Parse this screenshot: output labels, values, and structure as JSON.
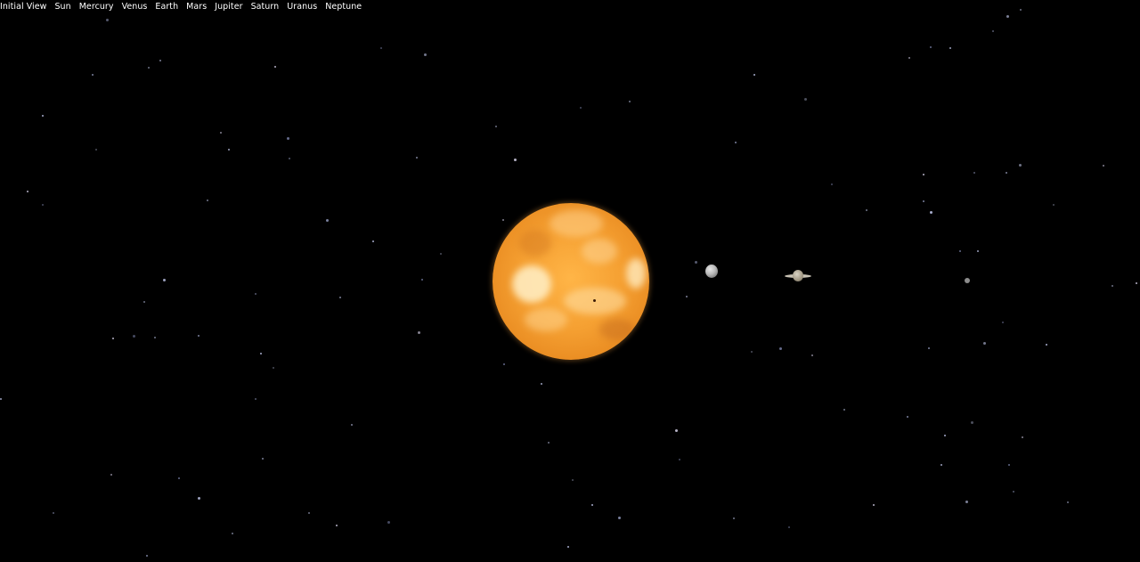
{
  "nav": {
    "items": [
      "Initial View",
      "Sun",
      "Mercury",
      "Venus",
      "Earth",
      "Mars",
      "Jupiter",
      "Saturn",
      "Uranus",
      "Neptune"
    ]
  },
  "scene": {
    "background": "#000000",
    "bodies": [
      "sun-sphere",
      "mercury-sphere",
      "saturn-with-rings",
      "distant-planet"
    ]
  },
  "colors": {
    "nav_text": "#ffffff",
    "sun": "#f5a032",
    "star": "#9aa2c8"
  }
}
